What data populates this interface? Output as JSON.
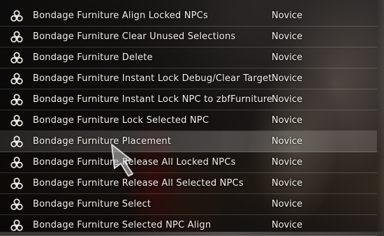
{
  "spell_list": {
    "items": [
      {
        "name": "Bondage Furniture Align Locked NPCs",
        "level": "Novice",
        "icon": "triskelion-icon",
        "selected": false
      },
      {
        "name": "Bondage Furniture Clear Unused Selections",
        "level": "Novice",
        "icon": "triskelion-icon",
        "selected": false
      },
      {
        "name": "Bondage Furniture Delete",
        "level": "Novice",
        "icon": "triskelion-icon",
        "selected": false
      },
      {
        "name": "Bondage Furniture Instant Lock Debug/Clear Target",
        "level": "Novice",
        "icon": "triskelion-icon",
        "selected": false
      },
      {
        "name": "Bondage Furniture Instant Lock NPC to zbfFurniture",
        "level": "Novice",
        "icon": "triskelion-icon",
        "selected": false
      },
      {
        "name": "Bondage Furniture Lock Selected NPC",
        "level": "Novice",
        "icon": "triskelion-icon",
        "selected": false
      },
      {
        "name": "Bondage Furniture Placement",
        "level": "Novice",
        "icon": "triskelion-icon",
        "selected": true
      },
      {
        "name": "Bondage Furniture Release All Locked NPCs",
        "level": "Novice",
        "icon": "triskelion-icon",
        "selected": false
      },
      {
        "name": "Bondage Furniture Release All Selected NPCs",
        "level": "Novice",
        "icon": "triskelion-icon",
        "selected": false
      },
      {
        "name": "Bondage Furniture Select",
        "level": "Novice",
        "icon": "triskelion-icon",
        "selected": false
      },
      {
        "name": "Bondage Furniture Selected NPC Align",
        "level": "Novice",
        "icon": "triskelion-icon",
        "selected": false
      }
    ]
  },
  "cursor": {
    "icon": "pointer-cursor-icon"
  }
}
